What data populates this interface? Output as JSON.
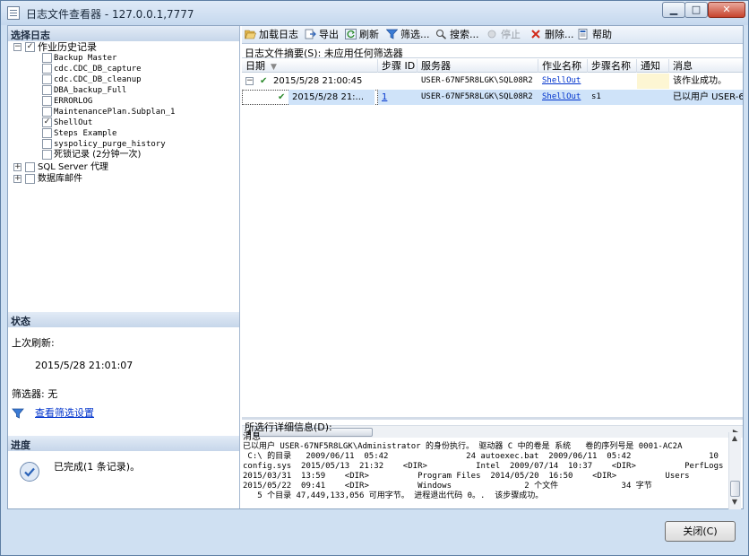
{
  "window": {
    "title": "日志文件查看器 - 127.0.0.1,7777",
    "min_glyph": "▁",
    "max_glyph": "□",
    "close_glyph": "✕"
  },
  "left": {
    "select_log_header": "选择日志",
    "tree": {
      "job_history": "作业历史记录",
      "jobs": [
        {
          "label": "Backup Master",
          "checked": false
        },
        {
          "label": "cdc.CDC_DB_capture",
          "checked": false
        },
        {
          "label": "cdc.CDC_DB_cleanup",
          "checked": false
        },
        {
          "label": "DBA_backup_Full",
          "checked": false
        },
        {
          "label": "ERRORLOG",
          "checked": false
        },
        {
          "label": "MaintenancePlan.Subplan_1",
          "checked": false
        },
        {
          "label": "ShellOut",
          "checked": true
        },
        {
          "label": "Steps Example",
          "checked": false
        },
        {
          "label": "syspolicy_purge_history",
          "checked": false
        },
        {
          "label": "死锁记录 (2分钟一次)",
          "checked": false
        }
      ],
      "sql_agent": "SQL Server 代理",
      "db_mail": "数据库邮件"
    },
    "status": {
      "header": "状态",
      "last_refresh_label": "上次刷新:",
      "last_refresh_value": "2015/5/28 21:01:07",
      "filter_label": "筛选器: 无",
      "view_filter_link": "查看筛选设置"
    },
    "progress": {
      "header": "进度",
      "text": "已完成(1 条记录)。"
    }
  },
  "toolbar": {
    "load_log": "加载日志",
    "export": "导出",
    "refresh": "刷新",
    "filter": "筛选...",
    "search": "搜索...",
    "stop": "停止",
    "delete": "删除...",
    "help": "帮助"
  },
  "summary": "日志文件摘要(S): 未应用任何筛选器",
  "grid": {
    "columns": [
      "日期",
      "步骤 ID",
      "服务器",
      "作业名称",
      "步骤名称",
      "通知",
      "消息"
    ],
    "rows": [
      {
        "date": "2015/5/28 21:00:45",
        "step_id": "",
        "server": "USER-67NF5R8LGK\\SQL08R2",
        "job": "ShellOut",
        "step": "",
        "notify": "",
        "message": "该作业成功。"
      },
      {
        "date": "2015/5/28 21:...",
        "step_id": "1",
        "server": "USER-67NF5R8LGK\\SQL08R2",
        "job": "ShellOut",
        "step": "s1",
        "notify": "",
        "message": "已以用户 USER-6"
      }
    ]
  },
  "details": {
    "header": "所选行详细信息(D):",
    "lines": [
      "消息",
      "已以用户 USER-67NF5R8LGK\\Administrator 的身份执行。 驱动器 C 中的卷是 系统   卷的序列号是 0001-AC2A",
      " C:\\ 的目录   2009/06/11  05:42                24 autoexec.bat  2009/06/11  05:42                10",
      "config.sys  2015/05/13  21:32    <DIR>          Intel  2009/07/14  10:37    <DIR>          PerfLogs",
      "2015/03/31  13:59    <DIR>          Program Files  2014/05/20  16:50    <DIR>          Users",
      "2015/05/22  09:41    <DIR>          Windows               2 个文件             34 字节",
      "   5 个目录 47,449,133,056 可用字节。 进程退出代码 0。.  该步骤成功。"
    ]
  },
  "close_button": "关闭(C)"
}
